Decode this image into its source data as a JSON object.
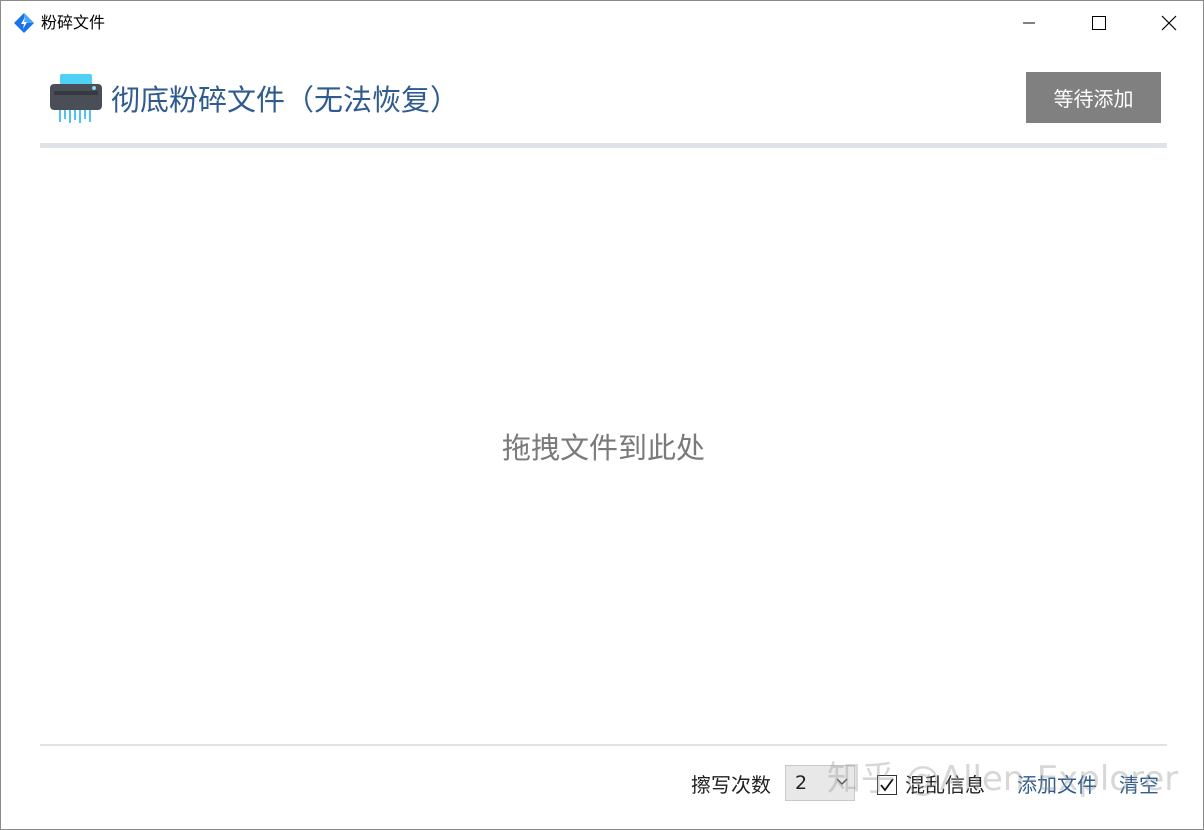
{
  "window": {
    "title": "粉碎文件"
  },
  "header": {
    "title": "彻底粉碎文件（无法恢复）",
    "status_button": "等待添加"
  },
  "drop_zone": {
    "hint": "拖拽文件到此处"
  },
  "footer": {
    "passes_label": "擦写次数",
    "passes_value": "2",
    "scramble_label": "混乱信息",
    "scramble_checked": true,
    "add_file_label": "添加文件",
    "clear_label": "清空"
  },
  "watermark": {
    "text": "知乎 @Allen-Explorer"
  },
  "colors": {
    "accent": "#2f5b8e",
    "status_button_bg": "#808080",
    "divider": "#dfe3e8",
    "hint_text": "#7a7a7a"
  },
  "icons": {
    "app": "app-diamond-icon",
    "header": "shredder-icon",
    "minimize": "minimize-icon",
    "maximize": "maximize-icon",
    "close": "close-icon",
    "dropdown": "chevron-down-icon",
    "checkbox": "checkmark-icon"
  }
}
